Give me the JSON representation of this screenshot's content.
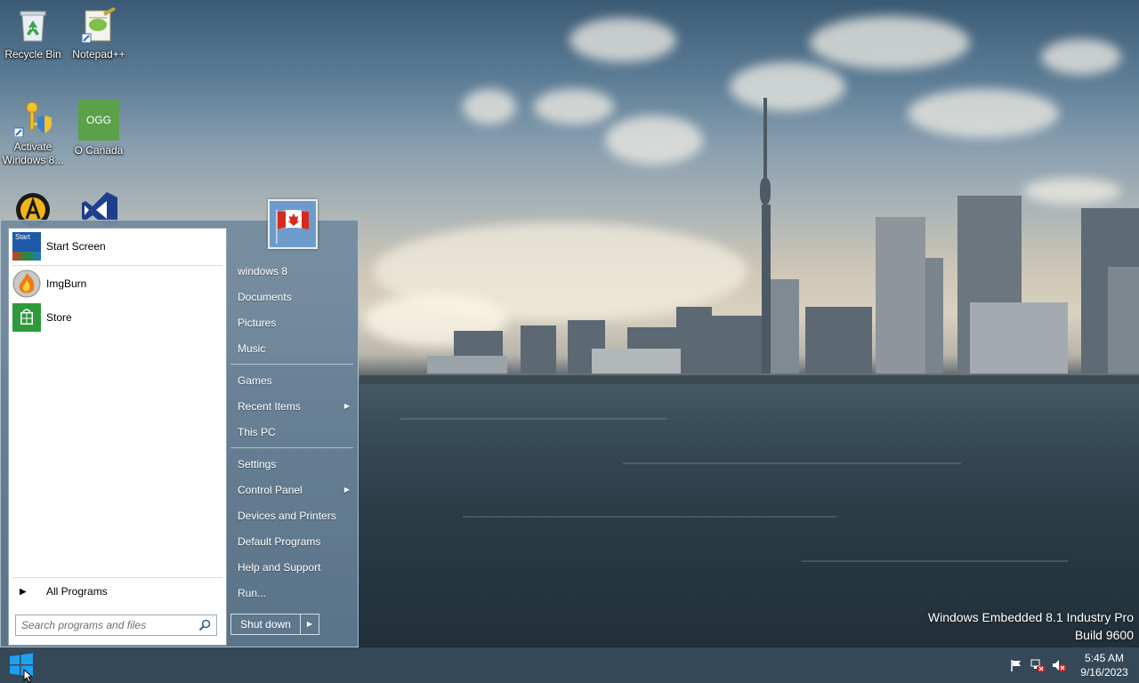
{
  "desktop": {
    "icons": [
      {
        "label": "Recycle Bin"
      },
      {
        "label": "Notepad++"
      },
      {
        "label": "Activate Windows 8..."
      },
      {
        "label": "O Canada",
        "badge": "OGG"
      }
    ],
    "partial_icons": [
      "app-icon-a",
      "visual-studio-icon"
    ]
  },
  "watermark": {
    "line1": "Windows Embedded 8.1 Industry Pro",
    "line2": "Build 9600"
  },
  "start_menu": {
    "pinned": [
      {
        "label": "Start Screen",
        "icon_badge": "Start"
      },
      {
        "label": "ImgBurn"
      },
      {
        "label": "Store"
      }
    ],
    "all_programs": "All Programs",
    "search_placeholder": "Search programs and files",
    "right_links": [
      {
        "label": "windows 8"
      },
      {
        "label": "Documents"
      },
      {
        "label": "Pictures"
      },
      {
        "label": "Music"
      },
      {
        "label": "Games"
      },
      {
        "label": "Recent Items"
      },
      {
        "label": "This PC"
      },
      {
        "label": "Settings"
      },
      {
        "label": "Control Panel"
      },
      {
        "label": "Devices and Printers"
      },
      {
        "label": "Default Programs"
      },
      {
        "label": "Help and Support"
      },
      {
        "label": "Run..."
      }
    ],
    "shutdown_label": "Shut down"
  },
  "taskbar": {
    "clock_time": "5:45 AM",
    "clock_date": "9/16/2023"
  },
  "colors": {
    "start_menu_bg": "#748ca0",
    "taskbar_bg": "#384c5c",
    "windows_logo": "#1ea0f0",
    "store_green": "#2e9a3c"
  }
}
